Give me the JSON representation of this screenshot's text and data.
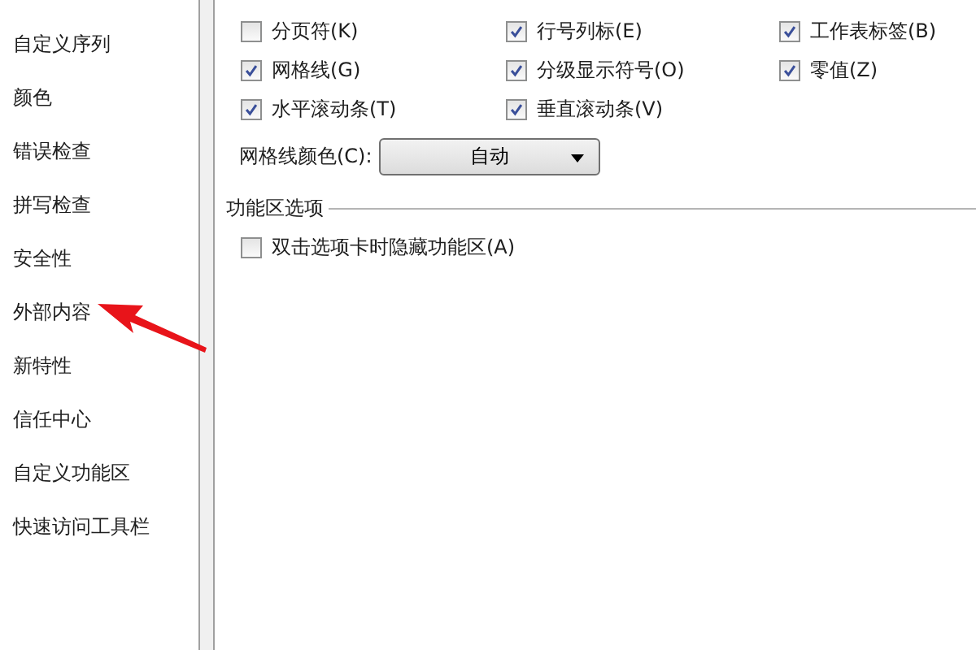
{
  "sidebar": {
    "items": [
      {
        "label": "自定义序列",
        "selected": false
      },
      {
        "label": "颜色",
        "selected": false
      },
      {
        "label": "错误检查",
        "selected": false
      },
      {
        "label": "拼写检查",
        "selected": false
      },
      {
        "label": "安全性",
        "selected": false
      },
      {
        "label": "外部内容",
        "selected": false
      },
      {
        "label": "新特性",
        "selected": false
      },
      {
        "label": "信任中心",
        "selected": false
      },
      {
        "label": "自定义功能区",
        "selected": false
      },
      {
        "label": "快速访问工具栏",
        "selected": false
      }
    ]
  },
  "display_options": [
    {
      "label": "分页符(K)",
      "checked": false
    },
    {
      "label": "行号列标(E)",
      "checked": true
    },
    {
      "label": "工作表标签(B)",
      "checked": true
    },
    {
      "label": "网格线(G)",
      "checked": true
    },
    {
      "label": "分级显示符号(O)",
      "checked": true
    },
    {
      "label": "零值(Z)",
      "checked": true
    },
    {
      "label": "水平滚动条(T)",
      "checked": true
    },
    {
      "label": "垂直滚动条(V)",
      "checked": true
    }
  ],
  "gridline_color": {
    "label": "网格线颜色(C):",
    "value": "自动"
  },
  "ribbon_section": {
    "title": "功能区选项",
    "options": [
      {
        "label": "双击选项卡时隐藏功能区(A)",
        "checked": false
      }
    ]
  }
}
